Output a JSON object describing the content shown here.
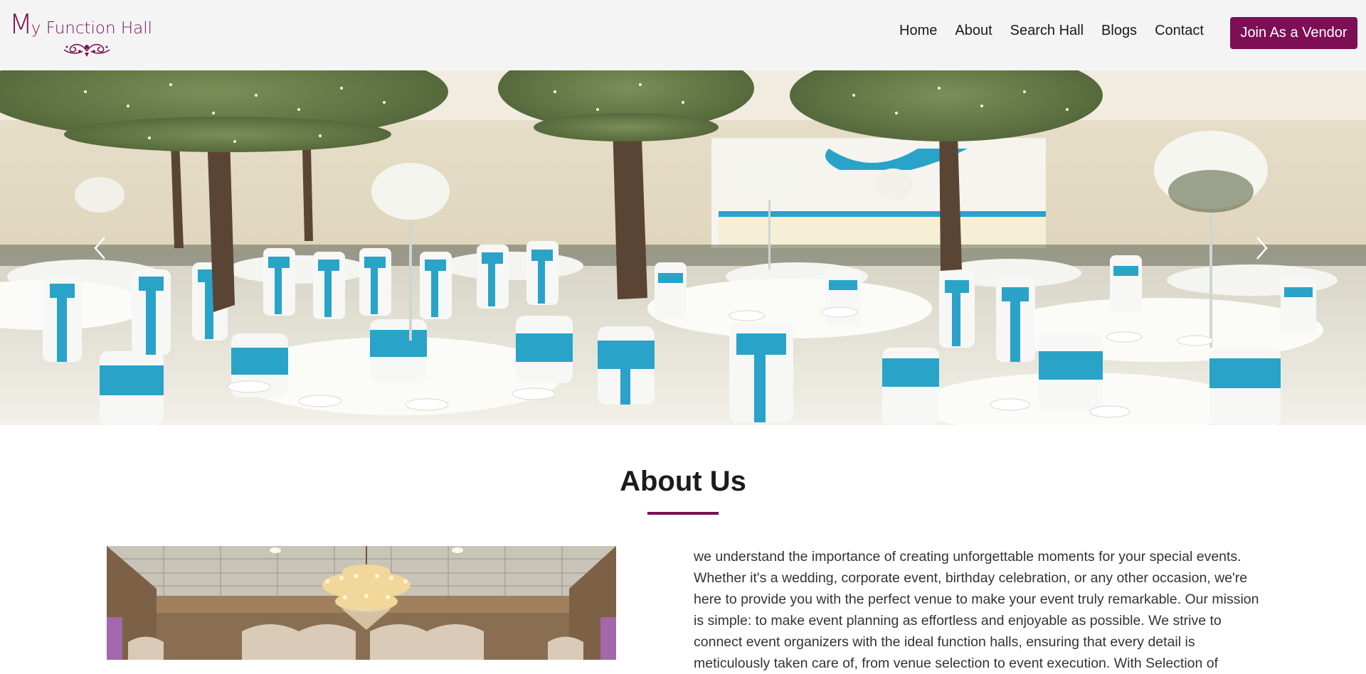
{
  "header": {
    "logo": {
      "initial": "M",
      "rest": "y Function Hall"
    },
    "nav": [
      {
        "label": "Home"
      },
      {
        "label": "About"
      },
      {
        "label": "Search Hall"
      },
      {
        "label": "Blogs"
      },
      {
        "label": "Contact"
      }
    ],
    "vendor_button": "Join As a Vendor"
  },
  "hero": {
    "image": "banquet-hall-photo",
    "prev_icon": "chevron-left-icon",
    "next_icon": "chevron-right-icon"
  },
  "about": {
    "title": "About Us",
    "image": "chandelier-hall-photo",
    "body": "we understand the importance of creating unforgettable moments for your special events. Whether it's a wedding, corporate event, birthday celebration, or any other occasion, we're here to provide you with the perfect venue to make your event truly remarkable. Our mission is simple: to make event planning as effortless and enjoyable as possible. We strive to connect event organizers with the ideal function halls, ensuring that every detail is meticulously taken care of, from venue selection to event execution. With Selection of"
  },
  "colors": {
    "brand": "#7d0f55",
    "header_bg": "#f4f4f4",
    "accent_sash": "#2aa3c8"
  }
}
